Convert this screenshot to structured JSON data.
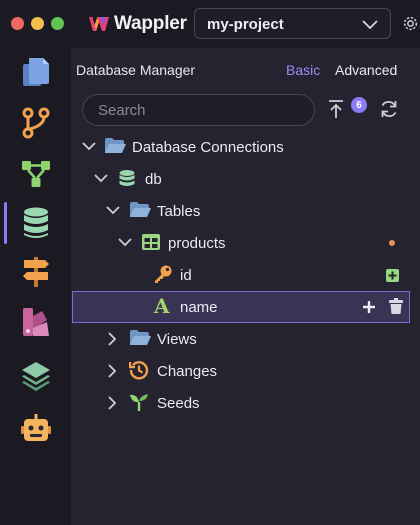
{
  "titlebar": {
    "app_name": "Wappler",
    "project": "my-project"
  },
  "rail": {
    "items": [
      {
        "icon": "files-icon"
      },
      {
        "icon": "git-branch-icon"
      },
      {
        "icon": "workflow-icon"
      },
      {
        "icon": "database-icon",
        "active": true
      },
      {
        "icon": "signpost-icon"
      },
      {
        "icon": "design-palette-icon"
      },
      {
        "icon": "layers-icon"
      },
      {
        "icon": "robot-icon"
      }
    ]
  },
  "panel": {
    "title": "Database Manager",
    "tabs": {
      "basic": "Basic",
      "advanced": "Advanced"
    },
    "search_placeholder": "Search",
    "badge_count": "6"
  },
  "tree": {
    "connections": "Database Connections",
    "db": "db",
    "tables": "Tables",
    "table_name": "products",
    "field_id": "id",
    "field_name": "name",
    "views": "Views",
    "changes": "Changes",
    "seeds": "Seeds"
  },
  "colors": {
    "accent": "#8b7cf6",
    "folder": "#8fb4dc",
    "database": "#9ad6b0",
    "table": "#9ad684",
    "key": "#f2a24d",
    "text_type": "#a6d46c",
    "modified_dot": "#e98f5a"
  }
}
